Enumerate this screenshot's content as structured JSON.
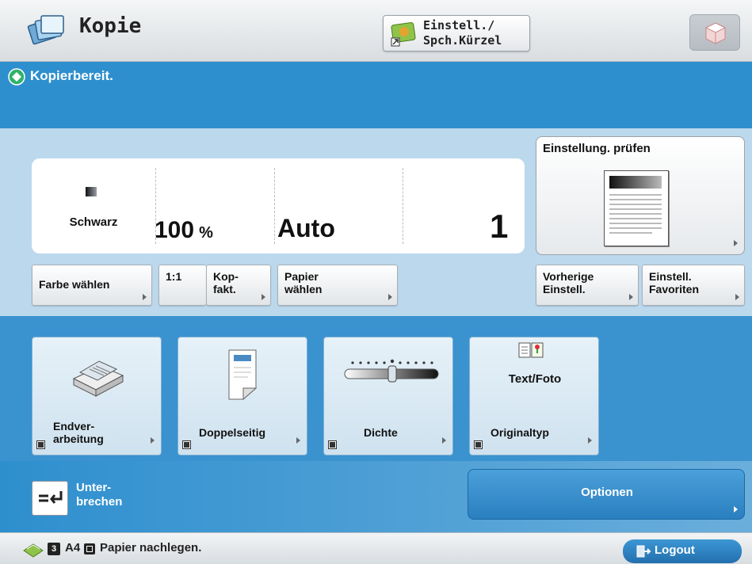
{
  "header": {
    "title": "Kopie",
    "shortcut_label": "Einstell./\nSpch.Kürzel"
  },
  "status": {
    "text": "Kopierbereit."
  },
  "summary": {
    "color": "Schwarz",
    "ratio_value": "100",
    "ratio_unit": "%",
    "paper": "Auto",
    "copies": "1"
  },
  "check_settings": {
    "label": "Einstellung. prüfen"
  },
  "setting_buttons": {
    "color_select": "Farbe wählen",
    "one_to_one": "1:1",
    "copy_ratio": "Kop-\nfakt.",
    "paper_select": "Papier\nwählen",
    "previous_settings": "Vorherige\nEinstell.",
    "favorites": "Einstell.\nFavoriten"
  },
  "function_buttons": {
    "finishing": "Endver-\narbeitung",
    "two_sided": "Doppelseitig",
    "density": "Dichte",
    "original_type": "Originaltyp",
    "original_type_value": "Text/Foto"
  },
  "bottom": {
    "interrupt": "Unter-\nbrechen",
    "options": "Optionen"
  },
  "footer": {
    "paper_tray_badge": "3",
    "paper_message": "A4",
    "paper_text": "Papier nachlegen.",
    "logout": "Logout"
  },
  "colors": {
    "status_blue": "#2e8fce",
    "panel_light": "#bcd8ec",
    "ready_green": "#2fb36b"
  },
  "icons": {
    "app": "copy-icon",
    "shortcut": "shortcut-icon",
    "cube": "cube-icon",
    "status": "ready-icon",
    "finishing": "stapler-icon",
    "two_sided": "duplex-icon",
    "density": "density-slider-icon",
    "original": "text-photo-icon",
    "interrupt": "interrupt-icon",
    "logout": "logout-icon"
  }
}
